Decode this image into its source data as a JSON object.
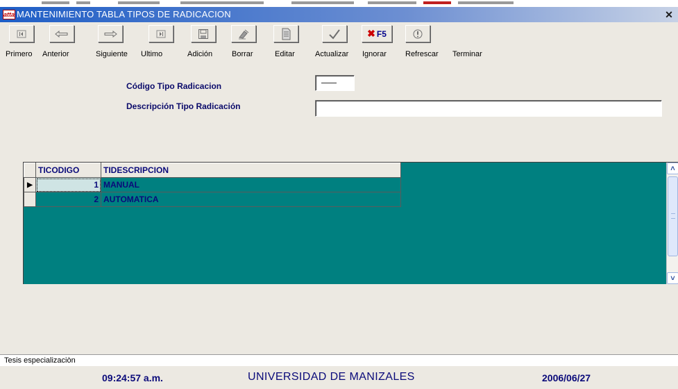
{
  "window": {
    "title": "MANTENIMIENTO TABLA TIPOS DE RADICACION",
    "app_icon_text": "atta",
    "close_symbol": "✕"
  },
  "toolbar": {
    "buttons": [
      {
        "name": "first",
        "icon": "first-record-icon"
      },
      {
        "name": "previous",
        "icon": "arrow-left-icon"
      },
      {
        "name": "next",
        "icon": "arrow-right-icon"
      },
      {
        "name": "last",
        "icon": "last-record-icon"
      },
      {
        "name": "add",
        "icon": "floppy-disk-icon"
      },
      {
        "name": "delete",
        "icon": "eraser-icon"
      },
      {
        "name": "edit",
        "icon": "edit-document-icon"
      },
      {
        "name": "update",
        "icon": "checkmark-icon"
      },
      {
        "name": "ignore",
        "icon": "x-f5-icon",
        "text": "F5"
      },
      {
        "name": "refresh",
        "icon": "refresh-icon"
      }
    ],
    "labels": {
      "first": "Primero",
      "previous": "Anterior",
      "next": "Siguiente",
      "last": "Ultimo",
      "add": "Adición",
      "delete": "Borrar",
      "edit": "Editar",
      "update": "Actualizar",
      "ignore": "Ignorar",
      "refresh": "Refrescar",
      "finish": "Terminar"
    }
  },
  "form": {
    "code_label": "Código Tipo Radicacion",
    "code_value": "",
    "description_label": "Descripción Tipo Radicación",
    "description_value": ""
  },
  "grid": {
    "columns": [
      "TICODIGO",
      "TIDESCRIPCION"
    ],
    "rows": [
      {
        "code": "1",
        "description": "MANUAL",
        "current": true
      },
      {
        "code": "2",
        "description": "AUTOMATICA",
        "current": false
      }
    ]
  },
  "status": {
    "message": "Tesis especializaciòn",
    "time": "09:24:57 a.m.",
    "institution": "UNIVERSIDAD DE MANIZALES",
    "date": "2006/06/27"
  },
  "colors": {
    "titlebar": "#1f5ec6",
    "grid_background": "#008080",
    "label_text": "#0a0a6a"
  }
}
